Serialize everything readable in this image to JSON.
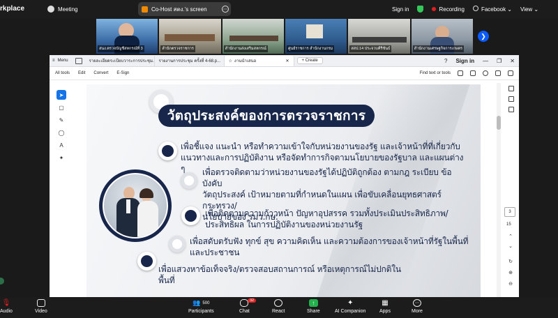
{
  "topbar": {
    "brand": "rkplace",
    "meeting_label": "Meeting",
    "cohost_label": "Co-Host สตง.'s screen",
    "sign_in": "Sign in",
    "recording": "Recording",
    "facebook": "Facebook ⌄",
    "view": "View ⌄"
  },
  "participants_strip": [
    {
      "name": "สนง.ตรวจบัญชีสหกรณ์ที่ 3"
    },
    {
      "name": "สำนักตรวจราชการ"
    },
    {
      "name": "สำนักงานส่งเสริมสหกรณ์"
    },
    {
      "name": "ศูนย์ราชการ สำนักงานกรม"
    },
    {
      "name": "สสป.14 ประจวบคีรีขันธ์"
    },
    {
      "name": "สำนักงานเศรษฐกิจการเกษตร"
    }
  ],
  "pdf": {
    "menu_label": "Menu",
    "tabs": [
      {
        "label": "รายละเอียดระเบียบวาระการประชุม..."
      },
      {
        "label": "รายงานการประชุม ครั้งที่ 4-68.p..."
      },
      {
        "label": "งานนำเสนอ"
      }
    ],
    "create_label": "Create",
    "sign_in": "Sign in",
    "toolbar": {
      "all_tools": "All tools",
      "edit": "Edit",
      "convert": "Convert",
      "esign": "E-Sign",
      "find": "Find text or tools"
    },
    "page_current": "3",
    "page_total": "15"
  },
  "slide": {
    "title": "วัตถุประสงค์ของการตรวจราชการ",
    "items": [
      {
        "line1": "เพื่อชี้แจง แนะนำ หรือทำความเข้าใจกับหน่วยงานของรัฐ และเจ้าหน้าที่ที่เกี่ยวกับ",
        "line2": "แนวทางและการปฏิบัติงาน หรือจัดทำการกิจตามนโยบายของรัฐบาล และแผนต่าง ๆ"
      },
      {
        "line1": "เพื่อตรวจติดตามว่าหน่วยงานของรัฐได้ปฏิบัติถูกต้อง ตามกฎ ระเบียบ ข้อบังคับ",
        "line2": "วัตถุประสงค์ เป้าหมายตามที่กำหนดในแผน เพื่อขับเคลื่อนยุทธศาสตร์กระทรวง/",
        "line3": "นโยบายของ รมว.กษ."
      },
      {
        "line1": "เพื่อติดตามความก้าวหน้า ปัญหาอุปสรรค รวมทั้งประเมินประสิทธิภาพ/",
        "line2": "ประสิทธิผล ในการปฏิบัติงานของหน่วยงานรัฐ"
      },
      {
        "line1": "เพื่อสดับตรับฟัง ทุกข์ สุข ความคิดเห็น และความต้องการของเจ้าหน้าที่รัฐในพื้นที่",
        "line2": "และประชาชน"
      },
      {
        "line1": "เพื่อแสวงหาข้อเท็จจริง/ตรวจสอบสถานการณ์ หรือเหตุการณ์ไม่ปกติใน",
        "line2": "พื้นที่"
      }
    ]
  },
  "bottombar": {
    "audio": "Audio",
    "video": "Video",
    "participants": "Participants",
    "participants_count": "500",
    "chat": "Chat",
    "chat_badge": "32",
    "react": "React",
    "share": "Share",
    "ai": "AI Companion",
    "apps": "Apps",
    "more": "More"
  },
  "colors": {
    "accent": "#17264a",
    "zoom_blue": "#0b5cff",
    "share_green": "#22b14c"
  }
}
